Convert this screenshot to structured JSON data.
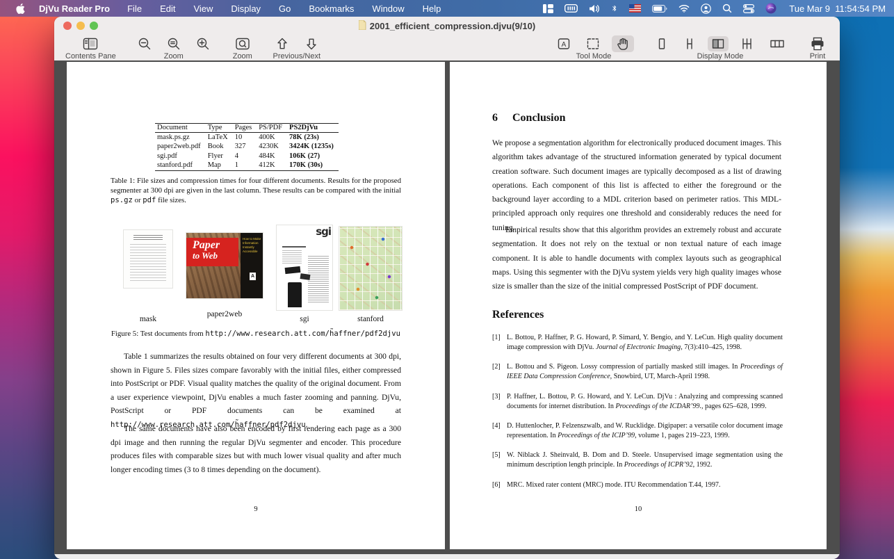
{
  "menu_bar": {
    "app_name": "DjVu Reader Pro",
    "menus": [
      "File",
      "Edit",
      "View",
      "Display",
      "Go",
      "Bookmarks",
      "Window",
      "Help"
    ],
    "status_icon_names": [
      "tiles-icon",
      "keyboard-icon",
      "volume-icon",
      "bluetooth-icon",
      "us-flag-input-icon",
      "battery-icon",
      "wifi-icon",
      "user-switch-icon",
      "spotlight-icon",
      "control-center-icon",
      "siri-icon"
    ],
    "clock": "Tue Mar 9  11:54:54 PM"
  },
  "window": {
    "title": "2001_efficient_compression.djvu(9/10)",
    "toolbar": {
      "contents_pane": "Contents Pane",
      "zoom": "Zoom",
      "zoom_marquee": "Zoom",
      "prev_next": "Previous/Next",
      "tool_mode": "Tool Mode",
      "display_mode": "Display Mode",
      "print": "Print"
    }
  },
  "left_page": {
    "table": {
      "headers": [
        "Document",
        "Type",
        "Pages",
        "PS/PDF",
        "PS2DjVu"
      ],
      "rows": [
        [
          "mask.ps.gz",
          "LaTeX",
          "10",
          "400K",
          "78K (23s)"
        ],
        [
          "paper2web.pdf",
          "Book",
          "327",
          "4230K",
          "3424K (1235s)"
        ],
        [
          "sgi.pdf",
          "Flyer",
          "4",
          "484K",
          "106K (27)"
        ],
        [
          "stanford.pdf",
          "Map",
          "1",
          "412K",
          "170K (30s)"
        ]
      ]
    },
    "table_caption": {
      "pre": "Table 1:  File sizes and compression times for four different documents.  Results for the proposed segmenter at 300 dpi are given in the last column.  These results can be compared with the initial ",
      "mono1": "ps.gz",
      "mid": " or ",
      "mono2": "pdf",
      "post": " file sizes."
    },
    "figure": {
      "labels": [
        "mask",
        "paper2web",
        "sgi",
        "stanford"
      ],
      "cover_title_line1": "Paper",
      "cover_title_line2": "to Web",
      "cover_side_text": "How to Make Information Instantly Accessible",
      "cover_logo_letter": "A",
      "sgi_logo": "sgi",
      "caption_pre": "Figure 5: Test documents from ",
      "caption_url": "http://www.research.att.com/h̃affner/pdf2djvu"
    },
    "para1_text": "Table 1 summarizes the results obtained on four very different documents at 300 dpi, shown in Figure 5. Files sizes compare favorably with the initial files, either compressed into PostScript or PDF. Visual quality matches the quality of the original document. From a user experience viewpoint, DjVu enables a much faster zooming and panning. DjVu, PostScript or PDF documents can be examined at ",
    "para1_url": "http://www.research.att.com/h̃affner/pdf2djvu",
    "para1_end": ".",
    "para2": "The same documents have also been encoded by first rendering each page as a 300 dpi image and then running the regular DjVu segmenter and encoder. This procedure produces files with comparable sizes but with much lower visual quality and after much longer encoding times (3 to 8 times depending on the document).",
    "page_number": "9"
  },
  "right_page": {
    "section_number": "6",
    "section_title": "Conclusion",
    "para1": "We propose a segmentation algorithm for electronically produced document images.  This algorithm takes advantage of the structured information generated by typical document creation software.  Such document images are typically decomposed as a list of drawing operations.  Each component of this list is affected to either the foreground or the background layer according to a MDL criterion based on perimeter ratios.  This MDL-principled approach only requires one threshold and considerably reduces the need for tuning.",
    "para2": "Empirical results show that this algorithm provides an extremely robust and accurate segmentation.  It does not rely on the textual or non textual nature of each image component. It is able to handle documents with complex layouts such as geographical maps.  Using this segmenter with the DjVu system yields very high quality images whose size is smaller than the size of the initial compressed PostScript of PDF document.",
    "references_title": "References",
    "references": [
      {
        "n": "[1]",
        "pre": "L. Bottou, P. Haffner, P. G. Howard, P. Simard, Y. Bengio, and Y. LeCun.  High quality document image compression with DjVu.  ",
        "it": "Journal of Electronic Imaging",
        "post": ", 7(3):410–425, 1998."
      },
      {
        "n": "[2]",
        "pre": "L. Bottou and S. Pigeon.  Lossy compression of partially masked still images.  In ",
        "it": "Proceedings of IEEE Data Compression Conference",
        "post": ", Snowbird, UT, March-April 1998."
      },
      {
        "n": "[3]",
        "pre": "P. Haffner, L. Bottou, P. G. Howard, and Y. LeCun.  DjVu :  Analyzing and compressing scanned documents for internet distribution. In ",
        "it": "Proceedings of the ICDAR’99.",
        "post": ", pages 625–628, 1999."
      },
      {
        "n": "[4]",
        "pre": "D. Huttenlocher, P. Felzenszwalb, and W. Rucklidge.  Digipaper:  a versatile color document image representation. In ",
        "it": "Proceedings of the ICIP’99",
        "post": ", volume 1, pages 219–223, 1999."
      },
      {
        "n": "[5]",
        "pre": "W. Niblack J. Sheinvald, B. Dom and D. Steele. Unsupervised image segmentation using the minimum description length principle. In ",
        "it": "Proceedings of ICPR’92",
        "post": ", 1992."
      },
      {
        "n": "[6]",
        "pre": "MRC. Mixed rater content (MRC) mode. ITU Recommendation T.44, 1997.",
        "it": "",
        "post": ""
      }
    ],
    "page_number": "10"
  },
  "colors": {
    "accent_red_cover": "#d6231f",
    "traffic_close": "#ed6a5e",
    "traffic_min": "#f5bd4f",
    "traffic_max": "#61c454",
    "content_bg": "#4d4d4d"
  }
}
